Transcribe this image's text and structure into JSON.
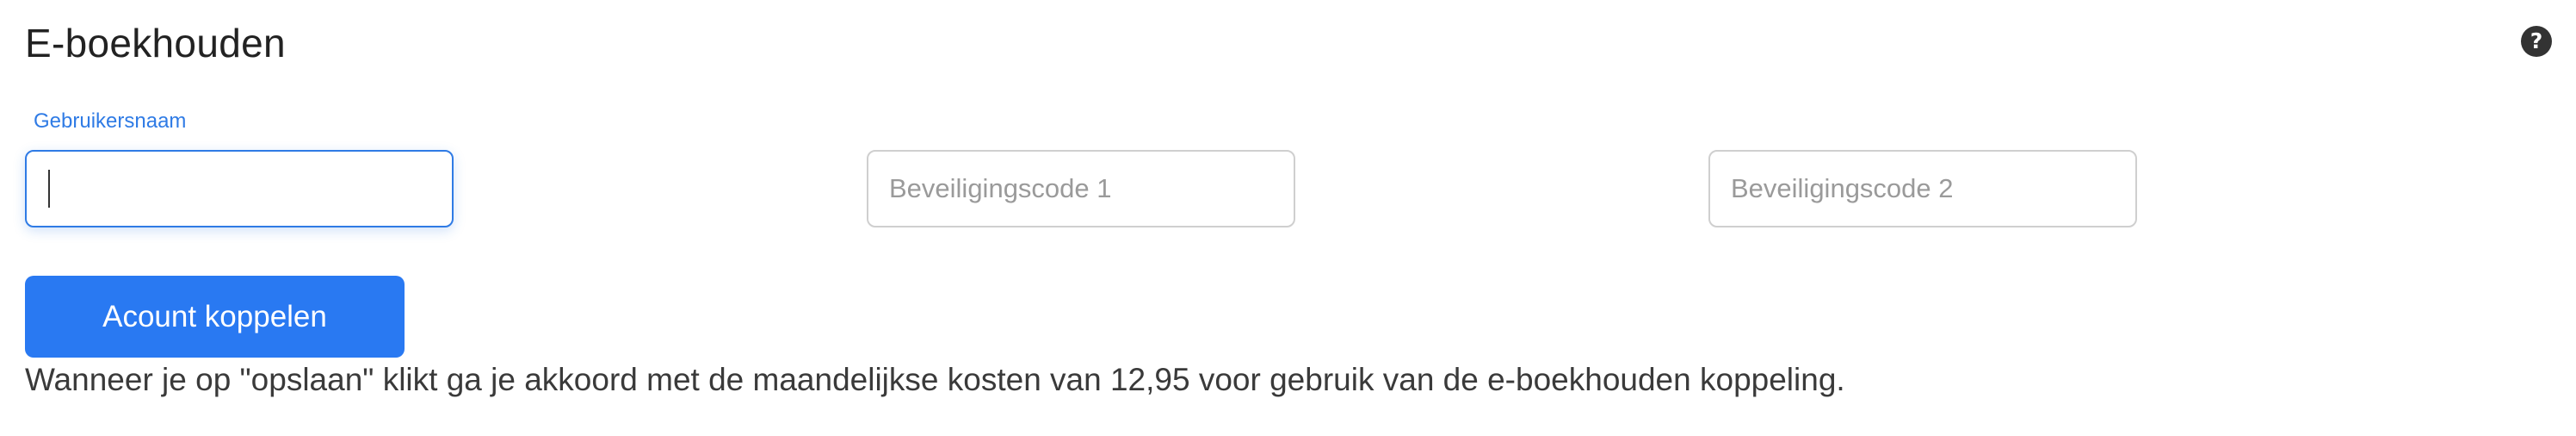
{
  "header": {
    "title": "E-boekhouden",
    "help_icon": "question-circle-icon"
  },
  "form": {
    "username": {
      "label": "Gebruikersnaam",
      "value": "",
      "placeholder": ""
    },
    "security_code_1": {
      "value": "",
      "placeholder": "Beveiligingscode 1"
    },
    "security_code_2": {
      "value": "",
      "placeholder": "Beveiligingscode 2"
    },
    "submit_label": "Acount koppelen",
    "notice": "Wanneer je op \"opslaan\" klikt ga je akkoord met de maandelijkse kosten van 12,95 voor gebruik van de e-boekhouden koppeling."
  },
  "colors": {
    "accent": "#2979f2",
    "label_active": "#2f7be5",
    "input_border": "#cfcfcf",
    "placeholder": "#9a9a9a"
  }
}
